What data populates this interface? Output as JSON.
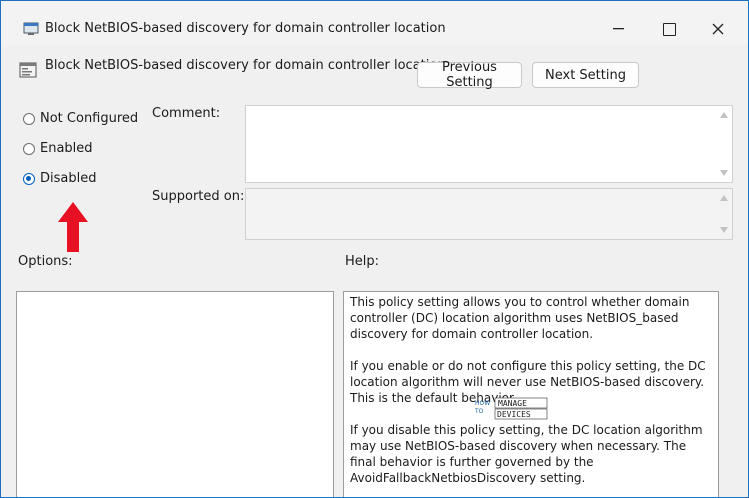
{
  "window": {
    "title": "Block NetBIOS-based discovery for domain controller location"
  },
  "header": {
    "policy_name": "Block NetBIOS-based discovery for domain controller location",
    "previous_label": "Previous Setting",
    "next_label": "Next Setting"
  },
  "state": {
    "options": [
      {
        "label": "Not Configured",
        "checked": false
      },
      {
        "label": "Enabled",
        "checked": false
      },
      {
        "label": "Disabled",
        "checked": true
      }
    ]
  },
  "comment": {
    "label": "Comment:",
    "value": ""
  },
  "supported_on": {
    "label": "Supported on:",
    "value": ""
  },
  "options_section": {
    "label": "Options:"
  },
  "help": {
    "label": "Help:",
    "paragraphs": [
      "This policy setting allows you to control whether domain controller (DC) location algorithm uses NetBIOS_based discovery for domain controller location.",
      "If you enable or do not configure this policy setting, the DC location algorithm will never use NetBIOS-based discovery. This is the default behavior.",
      "If you disable this policy setting, the DC location algorithm may use NetBIOS-based discovery when necessary. The final behavior is further governed by the AvoidFallbackNetbiosDiscovery setting."
    ]
  },
  "watermark": {
    "line1": "HOW TO",
    "line2": "MANAGE",
    "line3": "DEVICES"
  },
  "colors": {
    "accent": "#0061b9",
    "annotation_arrow": "#e81123",
    "frame": "#1f7fd0"
  }
}
